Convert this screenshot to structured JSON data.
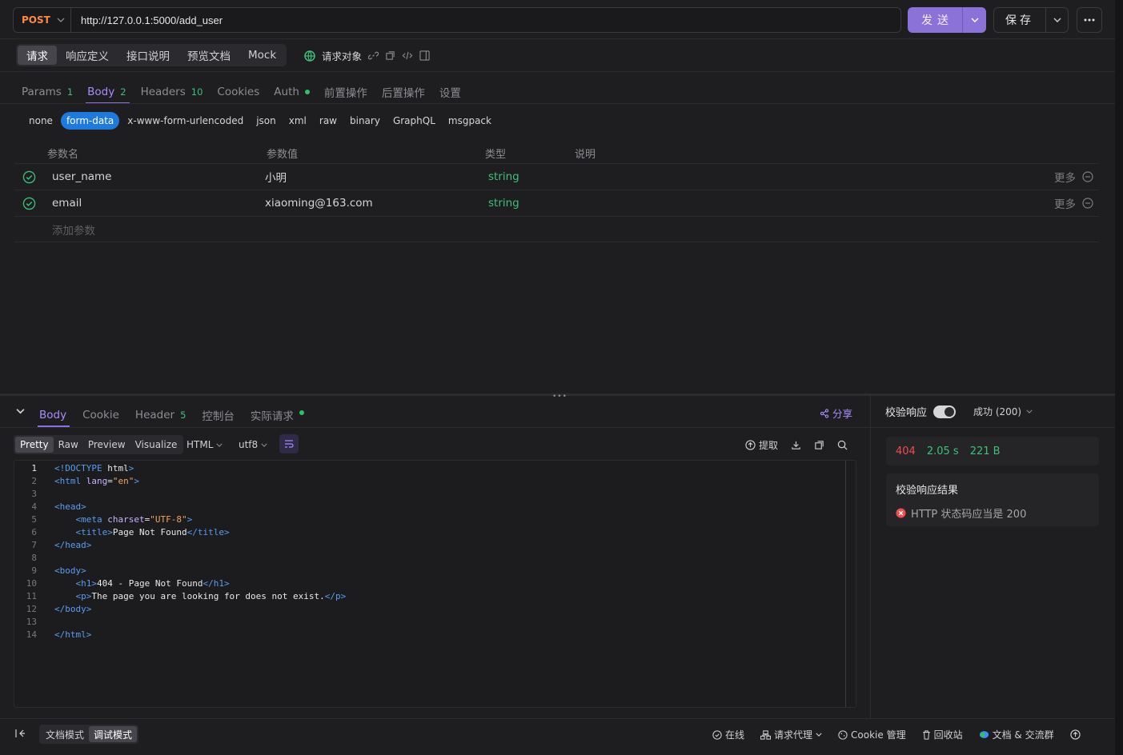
{
  "request": {
    "method": "POST",
    "url": "http://127.0.0.1:5000/add_user",
    "send_label": "发送",
    "save_label": "保存"
  },
  "mode_tabs": [
    "请求",
    "响应定义",
    "接口说明",
    "预览文档",
    "Mock"
  ],
  "request_object_label": "请求对象",
  "sub_tabs": [
    {
      "label": "Params",
      "badge": "1"
    },
    {
      "label": "Body",
      "badge": "2"
    },
    {
      "label": "Headers",
      "badge": "10"
    },
    {
      "label": "Cookies",
      "badge": ""
    },
    {
      "label": "Auth",
      "badge": ""
    },
    {
      "label": "前置操作",
      "badge": ""
    },
    {
      "label": "后置操作",
      "badge": ""
    },
    {
      "label": "设置",
      "badge": ""
    }
  ],
  "body_types": [
    "none",
    "form-data",
    "x-www-form-urlencoded",
    "json",
    "xml",
    "raw",
    "binary",
    "GraphQL",
    "msgpack"
  ],
  "params_table": {
    "headers": [
      "参数名",
      "参数值",
      "类型",
      "说明"
    ],
    "rows": [
      {
        "name": "user_name",
        "value": "小明",
        "type": "string",
        "more": "更多"
      },
      {
        "name": "email",
        "value": "xiaoming@163.com",
        "type": "string",
        "more": "更多"
      }
    ],
    "add_placeholder": "添加参数"
  },
  "response_tabs": [
    {
      "label": "Body",
      "badge": ""
    },
    {
      "label": "Cookie",
      "badge": ""
    },
    {
      "label": "Header",
      "badge": "5"
    },
    {
      "label": "控制台",
      "badge": ""
    },
    {
      "label": "实际请求",
      "badge": ""
    }
  ],
  "share_label": "分享",
  "format_tabs": [
    "Pretty",
    "Raw",
    "Preview",
    "Visualize"
  ],
  "format_lang": "HTML",
  "encoding": "utf8",
  "extract_label": "提取",
  "code_lines": [
    "<!DOCTYPE html>",
    "<html lang=\"en\">",
    "",
    "<head>",
    "    <meta charset=\"UTF-8\">",
    "    <title>Page Not Found</title>",
    "</head>",
    "",
    "<body>",
    "    <h1>404 - Page Not Found</h1>",
    "    <p>The page you are looking for does not exist.</p>",
    "</body>",
    "",
    "</html>"
  ],
  "validation": {
    "title": "校验响应",
    "status_select": "成功 (200)",
    "status_code": "404",
    "time": "2.05 s",
    "size": "221 B",
    "result_title": "校验响应结果",
    "result_text": "HTTP 状态码应当是 200"
  },
  "footer": {
    "modes": [
      "文档模式",
      "调试模式"
    ],
    "online": "在线",
    "proxy": "请求代理",
    "cookie": "Cookie 管理",
    "trash": "回收站",
    "docs": "文档 & 交流群"
  },
  "colors": {
    "accent": "#8a72d9",
    "method": "#ff8a3d",
    "success": "#3ec07a",
    "error": "#f04d4d"
  }
}
